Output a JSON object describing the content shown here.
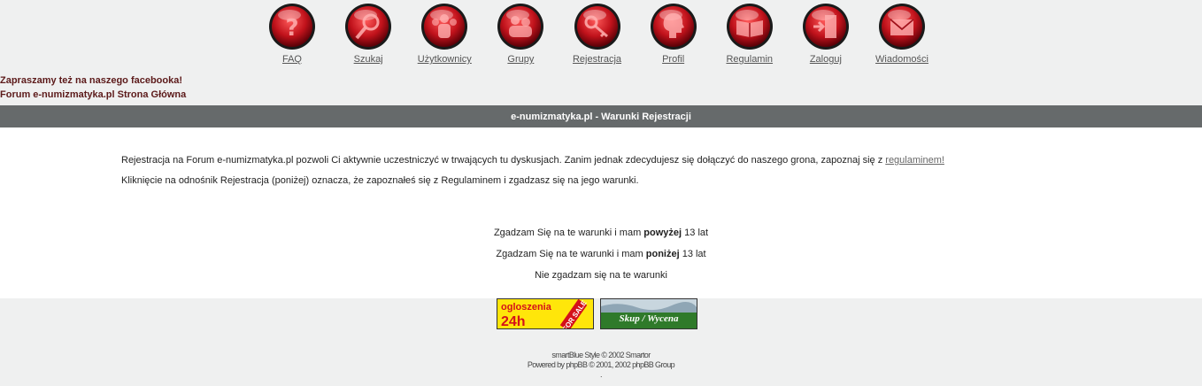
{
  "nav": [
    {
      "label": "FAQ",
      "icon": "question-icon"
    },
    {
      "label": "Szukaj",
      "icon": "magnifier-icon"
    },
    {
      "label": "Użytkownicy",
      "icon": "users-icon"
    },
    {
      "label": "Grupy",
      "icon": "group-icon"
    },
    {
      "label": "Rejestracja",
      "icon": "key-icon"
    },
    {
      "label": "Profil",
      "icon": "profile-head-icon"
    },
    {
      "label": "Regulamin",
      "icon": "book-icon"
    },
    {
      "label": "Zaloguj",
      "icon": "login-door-icon"
    },
    {
      "label": "Wiadomości",
      "icon": "envelope-icon"
    }
  ],
  "links": {
    "facebook": "Zapraszamy też na naszego facebooka!",
    "home": "Forum e-numizmatyka.pl Strona Główna"
  },
  "title_bar": "e-numizmatyka.pl - Warunki Rejestracji",
  "terms": {
    "p1_text": "Rejestracja na Forum e-numizmatyka.pl pozwoli Ci aktywnie uczestniczyć w trwających tu dyskusjach. Zanim jednak zdecydujesz się dołączyć do naszego grona, zapoznaj się z ",
    "p1_link": "regulaminem!",
    "p2": "Kliknięcie na odnośnik Rejestracja (poniżej) oznacza, że zapoznałeś się z Regulaminem i zgadzasz się na jego warunki."
  },
  "choices": {
    "above_pre": "Zgadzam Się na te warunki i mam ",
    "above_bold": "powyżej",
    "above_post": " 13 lat",
    "below_pre": "Zgadzam Się na te warunki i mam ",
    "below_bold": "poniżej",
    "below_post": " 13 lat",
    "disagree": "Nie zgadzam się na te warunki"
  },
  "banners": {
    "ads": {
      "line1": "ogloszenia",
      "line2": "24h",
      "sticker": "FOR SALE"
    },
    "buy": {
      "text": "Skup / Wycena"
    }
  },
  "footer": {
    "line1": "smartBlue Style © 2002 Smartor",
    "line2": "Powered by phpBB © 2001, 2002 phpBB Group",
    "line3": "."
  },
  "colors": {
    "title_bar": "#666a6b",
    "nav_orb": "#c0121b",
    "link_dark": "#5c1a1a"
  }
}
